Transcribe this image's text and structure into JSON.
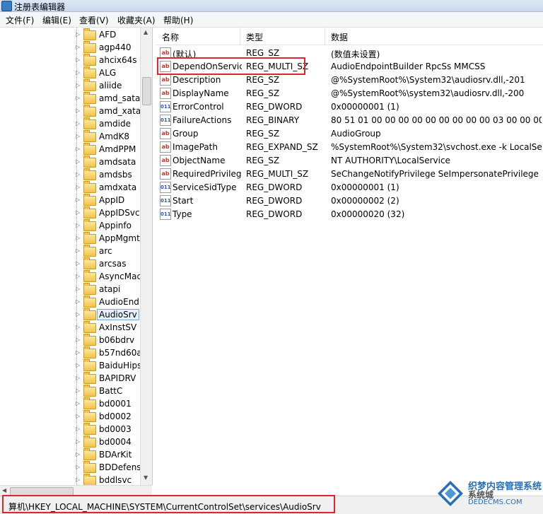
{
  "window": {
    "title": "注册表编辑器"
  },
  "menu": [
    "文件(F)",
    "编辑(E)",
    "查看(V)",
    "收藏夹(A)",
    "帮助(H)"
  ],
  "tree": {
    "items": [
      {
        "label": "AFD",
        "selected": false
      },
      {
        "label": "agp440",
        "selected": false
      },
      {
        "label": "ahcix64s",
        "selected": false
      },
      {
        "label": "ALG",
        "selected": false
      },
      {
        "label": "aliide",
        "selected": false
      },
      {
        "label": "amd_sata",
        "selected": false
      },
      {
        "label": "amd_xata",
        "selected": false
      },
      {
        "label": "amdide",
        "selected": false
      },
      {
        "label": "AmdK8",
        "selected": false
      },
      {
        "label": "AmdPPM",
        "selected": false
      },
      {
        "label": "amdsata",
        "selected": false
      },
      {
        "label": "amdsbs",
        "selected": false
      },
      {
        "label": "amdxata",
        "selected": false
      },
      {
        "label": "AppID",
        "selected": false
      },
      {
        "label": "AppIDSvc",
        "selected": false
      },
      {
        "label": "Appinfo",
        "selected": false
      },
      {
        "label": "AppMgmt",
        "selected": false
      },
      {
        "label": "arc",
        "selected": false
      },
      {
        "label": "arcsas",
        "selected": false
      },
      {
        "label": "AsyncMac",
        "selected": false
      },
      {
        "label": "atapi",
        "selected": false
      },
      {
        "label": "AudioEndp",
        "selected": false
      },
      {
        "label": "AudioSrv",
        "selected": true
      },
      {
        "label": "AxInstSV",
        "selected": false
      },
      {
        "label": "b06bdrv",
        "selected": false
      },
      {
        "label": "b57nd60a",
        "selected": false
      },
      {
        "label": "BaiduHips",
        "selected": false
      },
      {
        "label": "BAPIDRV",
        "selected": false
      },
      {
        "label": "BattC",
        "selected": false
      },
      {
        "label": "bd0001",
        "selected": false
      },
      {
        "label": "bd0002",
        "selected": false
      },
      {
        "label": "bd0003",
        "selected": false
      },
      {
        "label": "bd0004",
        "selected": false
      },
      {
        "label": "BDArKit",
        "selected": false
      },
      {
        "label": "BDDefense",
        "selected": false
      },
      {
        "label": "bddlsvc",
        "selected": false
      }
    ]
  },
  "list": {
    "columns": [
      "名称",
      "类型",
      "数据"
    ],
    "rows": [
      {
        "icon": "string-value-icon",
        "name": "(默认)",
        "type": "REG_SZ",
        "data": "(数值未设置)"
      },
      {
        "icon": "string-value-icon",
        "name": "DependOnService",
        "type": "REG_MULTI_SZ",
        "data": "AudioEndpointBuilder RpcSs MMCSS",
        "highlight": true
      },
      {
        "icon": "string-value-icon",
        "name": "Description",
        "type": "REG_SZ",
        "data": "@%SystemRoot%\\System32\\audiosrv.dll,-201"
      },
      {
        "icon": "string-value-icon",
        "name": "DisplayName",
        "type": "REG_SZ",
        "data": "@%SystemRoot%\\system32\\audiosrv.dll,-200"
      },
      {
        "icon": "binary-value-icon",
        "name": "ErrorControl",
        "type": "REG_DWORD",
        "data": "0x00000001 (1)"
      },
      {
        "icon": "binary-value-icon",
        "name": "FailureActions",
        "type": "REG_BINARY",
        "data": "80 51 01 00 00 00 00 00 00 00 00 00 03 00 00 00 14 00..."
      },
      {
        "icon": "string-value-icon",
        "name": "Group",
        "type": "REG_SZ",
        "data": "AudioGroup"
      },
      {
        "icon": "string-value-icon",
        "name": "ImagePath",
        "type": "REG_EXPAND_SZ",
        "data": "%SystemRoot%\\System32\\svchost.exe -k LocalSer..."
      },
      {
        "icon": "string-value-icon",
        "name": "ObjectName",
        "type": "REG_SZ",
        "data": "NT AUTHORITY\\LocalService"
      },
      {
        "icon": "string-value-icon",
        "name": "RequiredPrivilege...",
        "type": "REG_MULTI_SZ",
        "data": "SeChangeNotifyPrivilege SeImpersonatePrivilege S..."
      },
      {
        "icon": "binary-value-icon",
        "name": "ServiceSidType",
        "type": "REG_DWORD",
        "data": "0x00000001 (1)"
      },
      {
        "icon": "binary-value-icon",
        "name": "Start",
        "type": "REG_DWORD",
        "data": "0x00000002 (2)"
      },
      {
        "icon": "binary-value-icon",
        "name": "Type",
        "type": "REG_DWORD",
        "data": "0x00000020 (32)"
      }
    ]
  },
  "statusbar": {
    "path": "算机\\HKEY_LOCAL_MACHINE\\SYSTEM\\CurrentControlSet\\services\\AudioSrv"
  },
  "watermark": {
    "text": "织梦内容管理系统",
    "url": "DEDECMS.COM",
    "corner": "系统城",
    "sub": "xitongcheng.com"
  },
  "colors": {
    "highlight": "#e0252b",
    "selection": "#e5f1fb"
  }
}
